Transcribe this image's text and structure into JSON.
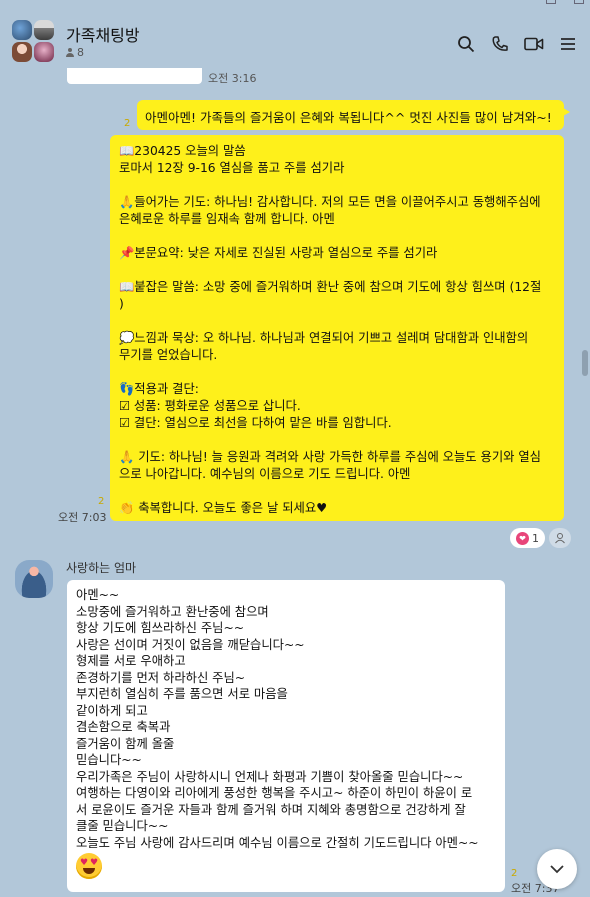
{
  "header": {
    "title": "가족채팅방",
    "member_count": "8"
  },
  "top_message": {
    "time": "오전 3:16"
  },
  "messages": {
    "m1": {
      "text": "아멘아멘! 가족들의 즐거움이 은혜와 복됩니다^^ 멋진 사진들 많이 남겨와~!",
      "unread": "2"
    },
    "m2": {
      "lines": [
        "📖230425 오늘의 말씀",
        "로마서 12장 9-16 열심을 품고 주를 섬기라",
        "",
        "🙏들어가는 기도: 하나님! 감사합니다. 저의 모든 면을 이끌어주시고 동행해주심에",
        "은혜로운 하루를 임재속 함께 합니다. 아멘",
        "",
        "📌본문요약: 낮은 자세로 진실된 사랑과 열심으로 주를 섬기라",
        "",
        "📖붙잡은 말씀: 소망 중에 즐거워하며 환난 중에 참으며 기도에 항상 힘쓰며 (12절",
        ")",
        "",
        "💭느낌과 묵상: 오 하나님. 하나님과 연결되어 기쁘고 설레며 담대함과 인내함의",
        "무기를 얻었습니다.",
        "",
        "👣적용과 결단:",
        "☑ 성품: 평화로운 성품으로 삽니다.",
        "☑ 결단: 열심으로 최선을 다하여 맡은 바를 임합니다.",
        "",
        "🙏 기도: 하나님! 늘 응원과 격려와 사랑 가득한 하루를 주심에 오늘도 용기와 열심",
        "으로 나아갑니다. 예수님의 이름으로 기도 드립니다. 아멘",
        "",
        "👏 축복합니다. 오늘도 좋은 날 되세요♥"
      ],
      "unread": "2",
      "time": "오전 7:03",
      "reaction_count": "1"
    },
    "m3": {
      "sender": "사랑하는 엄마",
      "lines": [
        "아멘~~",
        "소망중에 즐거워하고 환난중에 참으며",
        "항상 기도에 힘쓰라하신 주님~~",
        "사랑은 선이며 거짓이 없음을 깨닫습니다~~",
        "형제를 서로 우애하고",
        "존경하기를 먼저 하라하신 주님~",
        "부지런히 열심히 주를 품으면 서로 마음을",
        "같이하게 되고",
        "겸손함으로 축복과",
        "즐거움이 함께 올줄",
        "믿습니다~~",
        "우리가족은 주님이 사랑하시니 언제나 화평과 기쁨이 찾아올줄 믿습니다~~",
        "여행하는 다영이와 리아에게 풍성한 행복을 주시고~ 하준이 하민이 하윤이 로",
        "서 로윤이도 즐거운 자들과 함께 즐거워 하며 지혜와 총명함으로 건강하게 잘",
        "클줄 믿습니다~~",
        "오늘도 주님 사랑에 감사드리며 예수님 이름으로 간절히 기도드립니다 아멘~~"
      ],
      "unread": "2",
      "time": "오전 7:37"
    }
  },
  "icons": {
    "search": "search-icon",
    "call": "phone-icon",
    "video": "video-icon",
    "menu": "menu-icon"
  },
  "colors": {
    "background": "#b2c7d9",
    "my_bubble": "#fef01b",
    "other_bubble": "#ffffff",
    "unread": "#c9a900"
  }
}
